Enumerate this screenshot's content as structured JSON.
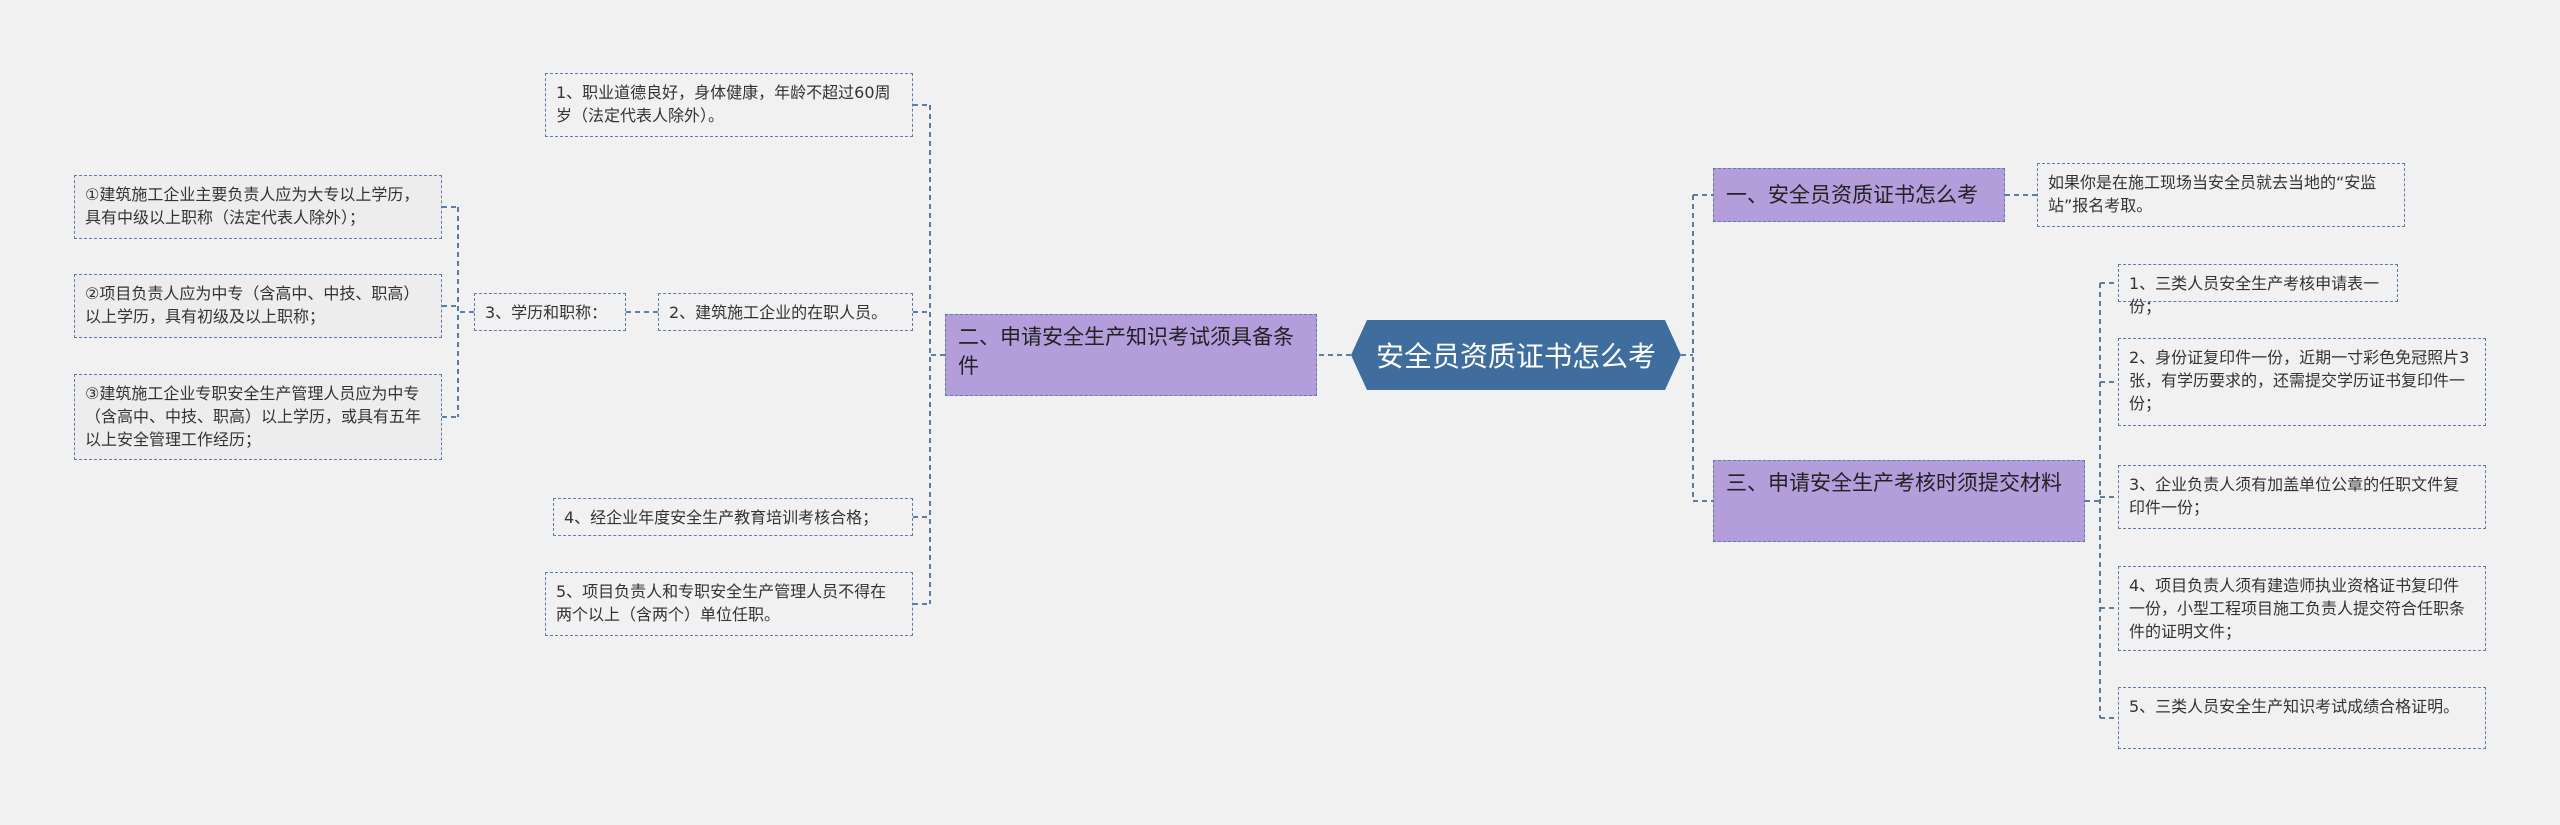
{
  "root": {
    "label": "安全员资质证书怎么考",
    "color": "#3f6e9e"
  },
  "colors": {
    "edge": "#4a6f99",
    "branch": "#b39ddb",
    "background": "#f1f1f1"
  },
  "branches": {
    "b1": {
      "label": "一、安全员资质证书怎么考",
      "children": [
        "如果你是在施工现场当安全员就去当地的“安监站”报名考取。"
      ]
    },
    "b2": {
      "label": "二、申请安全生产知识考试须具备条件",
      "children": {
        "c1": "1、职业道德良好，身体健康，年龄不超过60周岁（法定代表人除外）。",
        "c2": "2、建筑施工企业的在职人员。",
        "c3": "3、学历和职称：",
        "c3_items": [
          "①建筑施工企业主要负责人应为大专以上学历，具有中级以上职称（法定代表人除外）；",
          "②项目负责人应为中专（含高中、中技、职高）以上学历，具有初级及以上职称；",
          "③建筑施工企业专职安全生产管理人员应为中专（含高中、中技、职高）以上学历，或具有五年以上安全管理工作经历；"
        ],
        "c4": "4、经企业年度安全生产教育培训考核合格；",
        "c5": "5、项目负责人和专职安全生产管理人员不得在两个以上（含两个）单位任职。"
      }
    },
    "b3": {
      "label": "三、申请安全生产考核时须提交材料",
      "children": [
        "1、三类人员安全生产考核申请表一份；",
        "2、身份证复印件一份，近期一寸彩色免冠照片3张，有学历要求的，还需提交学历证书复印件一份；",
        "3、企业负责人须有加盖单位公章的任职文件复印件一份；",
        "4、项目负责人须有建造师执业资格证书复印件一份，小型工程项目施工负责人提交符合任职条件的证明文件；",
        "5、三类人员安全生产知识考试成绩合格证明。"
      ]
    }
  }
}
